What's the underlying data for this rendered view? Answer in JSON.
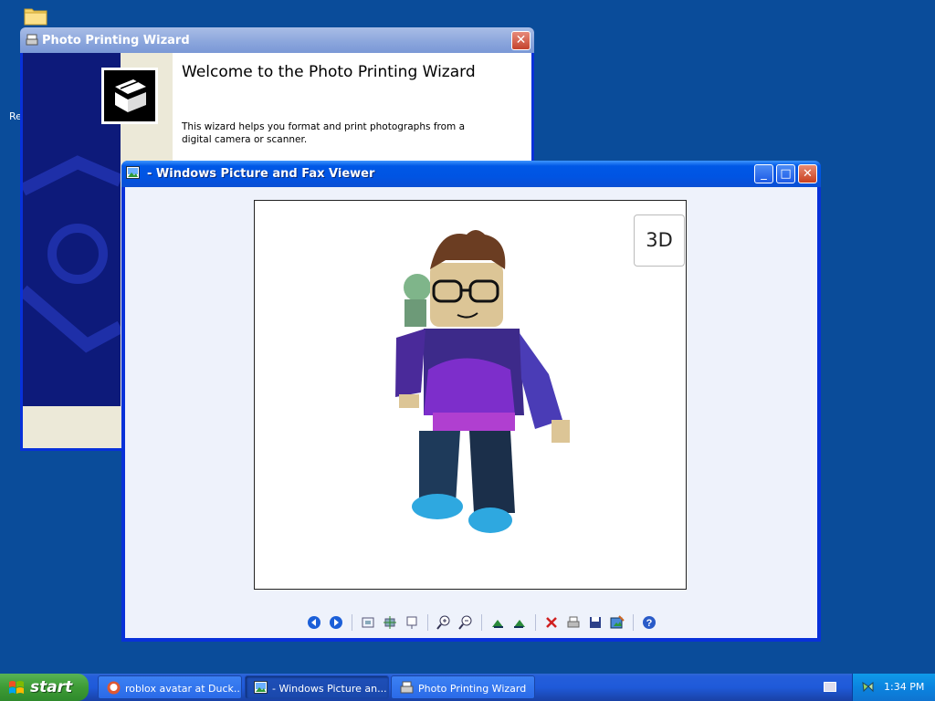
{
  "desktop": {
    "label_fragment": "Re"
  },
  "wizard": {
    "title": "Photo Printing Wizard",
    "heading": "Welcome to the Photo Printing Wizard",
    "description": "This wizard helps you format and print photographs from a digital camera or scanner."
  },
  "viewer": {
    "title": "- Windows Picture and Fax Viewer",
    "button_3d": "3D",
    "toolbar": [
      {
        "name": "previous-image-icon",
        "icon": "◀"
      },
      {
        "name": "next-image-icon",
        "icon": "▶"
      },
      {
        "name": "best-fit-icon",
        "icon": "▣"
      },
      {
        "name": "actual-size-icon",
        "icon": "✥"
      },
      {
        "name": "slideshow-icon",
        "icon": "▭"
      },
      {
        "name": "zoom-in-icon",
        "icon": "+"
      },
      {
        "name": "zoom-out-icon",
        "icon": "−"
      },
      {
        "name": "rotate-clockwise-icon",
        "icon": "▲"
      },
      {
        "name": "rotate-counterclockwise-icon",
        "icon": "▲"
      },
      {
        "name": "delete-icon",
        "icon": "✕"
      },
      {
        "name": "print-icon",
        "icon": "⎙"
      },
      {
        "name": "save-icon",
        "icon": "▪"
      },
      {
        "name": "edit-icon",
        "icon": "✎"
      },
      {
        "name": "help-icon",
        "icon": "?"
      }
    ]
  },
  "taskbar": {
    "start_label": "start",
    "tasks": [
      {
        "label": "roblox avatar at Duck..."
      },
      {
        "label": "- Windows Picture an..."
      },
      {
        "label": "Photo Printing Wizard"
      }
    ],
    "clock": "1:34 PM"
  },
  "colors": {
    "desktop": "#0a4c9a",
    "title_active": "#0054e3",
    "title_inactive": "#8aa5dc",
    "start_green": "#3d9b35",
    "close_red": "#c8401f"
  }
}
